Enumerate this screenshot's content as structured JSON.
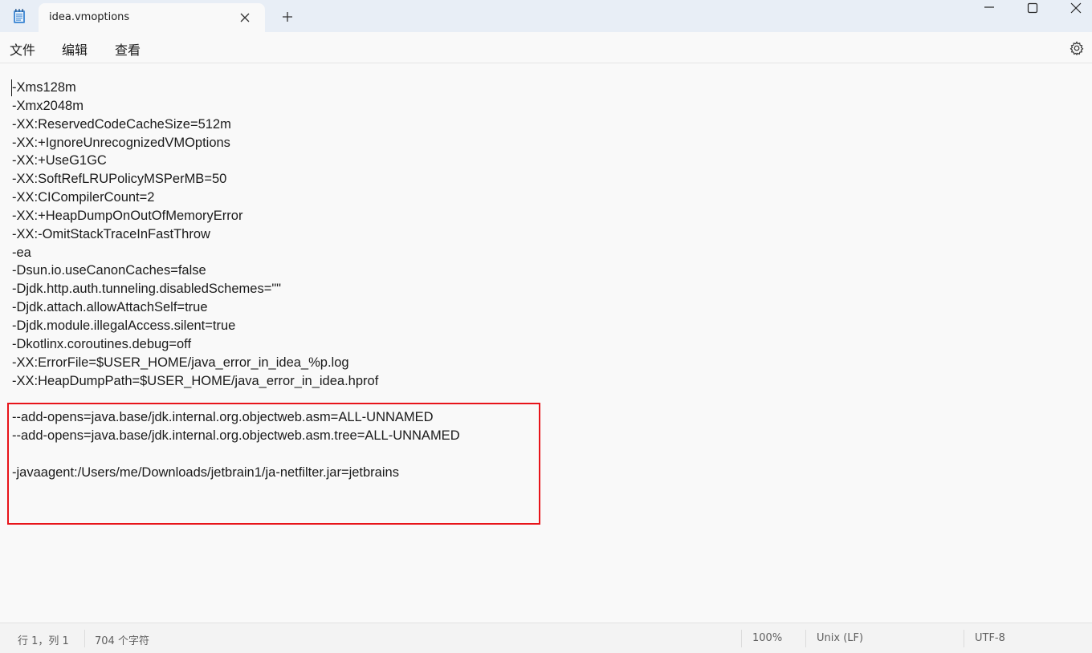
{
  "titlebar": {
    "tab_title": "idea.vmoptions",
    "new_tab_symbol": "+",
    "icons": [
      "notepad-icon",
      "close-icon",
      "plus-icon",
      "minimize-icon",
      "maximize-icon",
      "window-close-icon"
    ]
  },
  "menu": {
    "file": "文件",
    "edit": "编辑",
    "view": "查看",
    "settings_icon": "gear-icon"
  },
  "editor": {
    "lines": [
      "-Xms128m",
      "-Xmx2048m",
      "-XX:ReservedCodeCacheSize=512m",
      "-XX:+IgnoreUnrecognizedVMOptions",
      "-XX:+UseG1GC",
      "-XX:SoftRefLRUPolicyMSPerMB=50",
      "-XX:CICompilerCount=2",
      "-XX:+HeapDumpOnOutOfMemoryError",
      "-XX:-OmitStackTraceInFastThrow",
      "-ea",
      "-Dsun.io.useCanonCaches=false",
      "-Djdk.http.auth.tunneling.disabledSchemes=\"\"",
      "-Djdk.attach.allowAttachSelf=true",
      "-Djdk.module.illegalAccess.silent=true",
      "-Dkotlinx.coroutines.debug=off",
      "-XX:ErrorFile=$USER_HOME/java_error_in_idea_%p.log",
      "-XX:HeapDumpPath=$USER_HOME/java_error_in_idea.hprof",
      "",
      "--add-opens=java.base/jdk.internal.org.objectweb.asm=ALL-UNNAMED",
      "--add-opens=java.base/jdk.internal.org.objectweb.asm.tree=ALL-UNNAMED",
      "",
      "-javaagent:/Users/me/Downloads/jetbrain1/ja-netfilter.jar=jetbrains"
    ],
    "highlight_color": "#e8141a"
  },
  "status": {
    "position": "行 1，列 1",
    "char_count": "704 个字符",
    "zoom": "100%",
    "line_ending": "Unix (LF)",
    "encoding": "UTF-8"
  }
}
